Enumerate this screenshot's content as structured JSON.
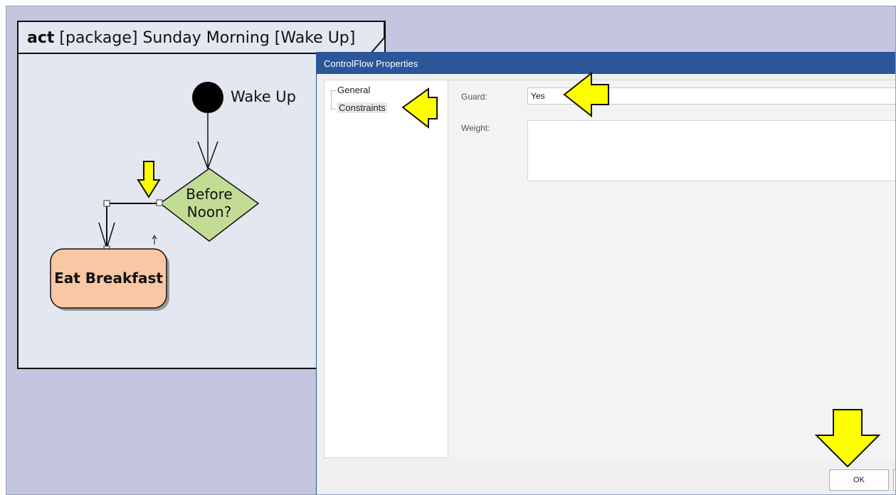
{
  "diagram": {
    "frame_keyword": "act",
    "frame_title": "[package] Sunday Morning [Wake Up]",
    "initial_node_label": "Wake Up",
    "decision_label_line1": "Before",
    "decision_label_line2": "Noon?",
    "action_label": "Eat Breakfast",
    "colors": {
      "decision_fill": "#c2dc96",
      "action_fill": "#f8c7a4",
      "highlight_arrow": "#ffff00"
    }
  },
  "dialog": {
    "title": "ControlFlow Properties",
    "tree_items": [
      "General",
      "Constraints"
    ],
    "guard_label": "Guard:",
    "guard_value": "Yes",
    "weight_label": "Weight:",
    "weight_value": "",
    "ok_label": "OK"
  }
}
